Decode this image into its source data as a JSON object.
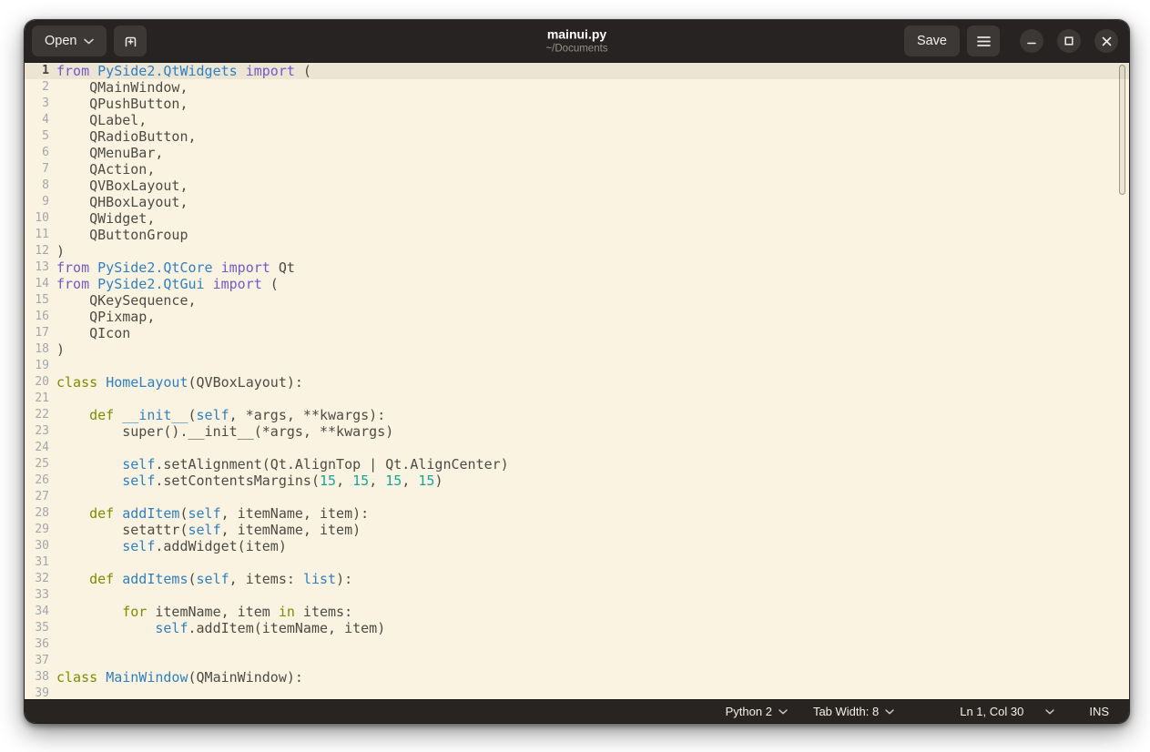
{
  "header": {
    "open_label": "Open",
    "title": "mainui.py",
    "subtitle": "~/Documents",
    "save_label": "Save"
  },
  "statusbar": {
    "language": "Python 2",
    "tab_width": "Tab Width: 8",
    "cursor_position": "Ln 1, Col 30",
    "insert_mode": "INS"
  },
  "colors": {
    "header-bg": "#262322",
    "button-bg": "#3b3836",
    "statusbar-bg": "#272422",
    "editor-bg": "#faf3e1",
    "current-line-bg": "#ece5d3",
    "line-number": "#a3a7ad",
    "line-number-current": "#45433f",
    "syntax-plain": "#4d4b45",
    "syntax-import": "#7459c9",
    "syntax-keyword": "#7f8b00",
    "syntax-name": "#2f80c2",
    "syntax-number": "#18a497"
  },
  "editor": {
    "current_line": 1,
    "lines": [
      {
        "no": 1,
        "seg": [
          [
            "imp",
            "from"
          ],
          [
            "p",
            " "
          ],
          [
            "name",
            "PySide2.QtWidgets"
          ],
          [
            "p",
            " "
          ],
          [
            "imp",
            "import"
          ],
          [
            "p",
            " ("
          ]
        ]
      },
      {
        "no": 2,
        "seg": [
          [
            "p",
            "    QMainWindow,"
          ]
        ]
      },
      {
        "no": 3,
        "seg": [
          [
            "p",
            "    QPushButton,"
          ]
        ]
      },
      {
        "no": 4,
        "seg": [
          [
            "p",
            "    QLabel,"
          ]
        ]
      },
      {
        "no": 5,
        "seg": [
          [
            "p",
            "    QRadioButton,"
          ]
        ]
      },
      {
        "no": 6,
        "seg": [
          [
            "p",
            "    QMenuBar,"
          ]
        ]
      },
      {
        "no": 7,
        "seg": [
          [
            "p",
            "    QAction,"
          ]
        ]
      },
      {
        "no": 8,
        "seg": [
          [
            "p",
            "    QVBoxLayout,"
          ]
        ]
      },
      {
        "no": 9,
        "seg": [
          [
            "p",
            "    QHBoxLayout,"
          ]
        ]
      },
      {
        "no": 10,
        "seg": [
          [
            "p",
            "    QWidget,"
          ]
        ]
      },
      {
        "no": 11,
        "seg": [
          [
            "p",
            "    QButtonGroup"
          ]
        ]
      },
      {
        "no": 12,
        "seg": [
          [
            "p",
            ")"
          ]
        ]
      },
      {
        "no": 13,
        "seg": [
          [
            "imp",
            "from"
          ],
          [
            "p",
            " "
          ],
          [
            "name",
            "PySide2.QtCore"
          ],
          [
            "p",
            " "
          ],
          [
            "imp",
            "import"
          ],
          [
            "p",
            " Qt"
          ]
        ]
      },
      {
        "no": 14,
        "seg": [
          [
            "imp",
            "from"
          ],
          [
            "p",
            " "
          ],
          [
            "name",
            "PySide2.QtGui"
          ],
          [
            "p",
            " "
          ],
          [
            "imp",
            "import"
          ],
          [
            "p",
            " ("
          ]
        ]
      },
      {
        "no": 15,
        "seg": [
          [
            "p",
            "    QKeySequence,"
          ]
        ]
      },
      {
        "no": 16,
        "seg": [
          [
            "p",
            "    QPixmap,"
          ]
        ]
      },
      {
        "no": 17,
        "seg": [
          [
            "p",
            "    QIcon"
          ]
        ]
      },
      {
        "no": 18,
        "seg": [
          [
            "p",
            ")"
          ]
        ]
      },
      {
        "no": 19,
        "seg": []
      },
      {
        "no": 20,
        "seg": [
          [
            "kw",
            "class"
          ],
          [
            "p",
            " "
          ],
          [
            "name",
            "HomeLayout"
          ],
          [
            "p",
            "(QVBoxLayout):"
          ]
        ]
      },
      {
        "no": 21,
        "seg": []
      },
      {
        "no": 22,
        "seg": [
          [
            "p",
            "    "
          ],
          [
            "kw",
            "def"
          ],
          [
            "p",
            " "
          ],
          [
            "name",
            "__init__"
          ],
          [
            "p",
            "("
          ],
          [
            "name",
            "self"
          ],
          [
            "p",
            ", *args, **kwargs):"
          ]
        ]
      },
      {
        "no": 23,
        "seg": [
          [
            "p",
            "        super().__init__(*args, **kwargs)"
          ]
        ]
      },
      {
        "no": 24,
        "seg": []
      },
      {
        "no": 25,
        "seg": [
          [
            "p",
            "        "
          ],
          [
            "name",
            "self"
          ],
          [
            "p",
            ".setAlignment(Qt.AlignTop | Qt.AlignCenter)"
          ]
        ]
      },
      {
        "no": 26,
        "seg": [
          [
            "p",
            "        "
          ],
          [
            "name",
            "self"
          ],
          [
            "p",
            ".setContentsMargins("
          ],
          [
            "num",
            "15"
          ],
          [
            "p",
            ", "
          ],
          [
            "num",
            "15"
          ],
          [
            "p",
            ", "
          ],
          [
            "num",
            "15"
          ],
          [
            "p",
            ", "
          ],
          [
            "num",
            "15"
          ],
          [
            "p",
            ")"
          ]
        ]
      },
      {
        "no": 27,
        "seg": []
      },
      {
        "no": 28,
        "seg": [
          [
            "p",
            "    "
          ],
          [
            "kw",
            "def"
          ],
          [
            "p",
            " "
          ],
          [
            "name",
            "addItem"
          ],
          [
            "p",
            "("
          ],
          [
            "name",
            "self"
          ],
          [
            "p",
            ", itemName, item):"
          ]
        ]
      },
      {
        "no": 29,
        "seg": [
          [
            "p",
            "        setattr("
          ],
          [
            "name",
            "self"
          ],
          [
            "p",
            ", itemName, item)"
          ]
        ]
      },
      {
        "no": 30,
        "seg": [
          [
            "p",
            "        "
          ],
          [
            "name",
            "self"
          ],
          [
            "p",
            ".addWidget(item)"
          ]
        ]
      },
      {
        "no": 31,
        "seg": []
      },
      {
        "no": 32,
        "seg": [
          [
            "p",
            "    "
          ],
          [
            "kw",
            "def"
          ],
          [
            "p",
            " "
          ],
          [
            "name",
            "addItems"
          ],
          [
            "p",
            "("
          ],
          [
            "name",
            "self"
          ],
          [
            "p",
            ", items: "
          ],
          [
            "name",
            "list"
          ],
          [
            "p",
            "):"
          ]
        ]
      },
      {
        "no": 33,
        "seg": []
      },
      {
        "no": 34,
        "seg": [
          [
            "p",
            "        "
          ],
          [
            "kw",
            "for"
          ],
          [
            "p",
            " itemName, item "
          ],
          [
            "kw",
            "in"
          ],
          [
            "p",
            " items:"
          ]
        ]
      },
      {
        "no": 35,
        "seg": [
          [
            "p",
            "            "
          ],
          [
            "name",
            "self"
          ],
          [
            "p",
            ".addItem(itemName, item)"
          ]
        ]
      },
      {
        "no": 36,
        "seg": []
      },
      {
        "no": 37,
        "seg": []
      },
      {
        "no": 38,
        "seg": [
          [
            "kw",
            "class"
          ],
          [
            "p",
            " "
          ],
          [
            "name",
            "MainWindow"
          ],
          [
            "p",
            "(QMainWindow):"
          ]
        ]
      },
      {
        "no": 39,
        "seg": []
      }
    ]
  }
}
